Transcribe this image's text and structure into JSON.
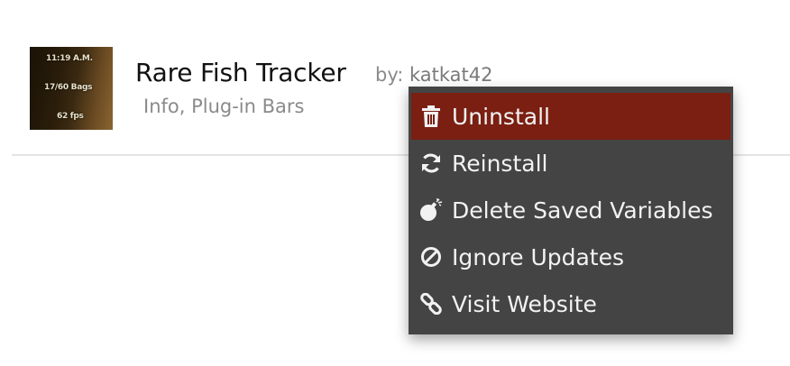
{
  "addon": {
    "name": "Rare Fish Tracker",
    "by_label": "by:",
    "author": "katkat42",
    "categories": "Info, Plug-in Bars",
    "thumbnail_lines": [
      "11:19 A.M.",
      "17/60 Bags",
      "62 fps"
    ]
  },
  "context_menu": {
    "items": [
      {
        "label": "Uninstall",
        "icon": "trash-icon",
        "active": true
      },
      {
        "label": "Reinstall",
        "icon": "refresh-icon",
        "active": false
      },
      {
        "label": "Delete Saved Variables",
        "icon": "bomb-icon",
        "active": false
      },
      {
        "label": "Ignore Updates",
        "icon": "ban-icon",
        "active": false
      },
      {
        "label": "Visit Website",
        "icon": "link-icon",
        "active": false
      }
    ]
  },
  "colors": {
    "menu_background": "#444444",
    "menu_active": "#7a1f12",
    "menu_text": "#f2f2f2",
    "title_text": "#111111",
    "muted_text": "#8a8a8a"
  }
}
